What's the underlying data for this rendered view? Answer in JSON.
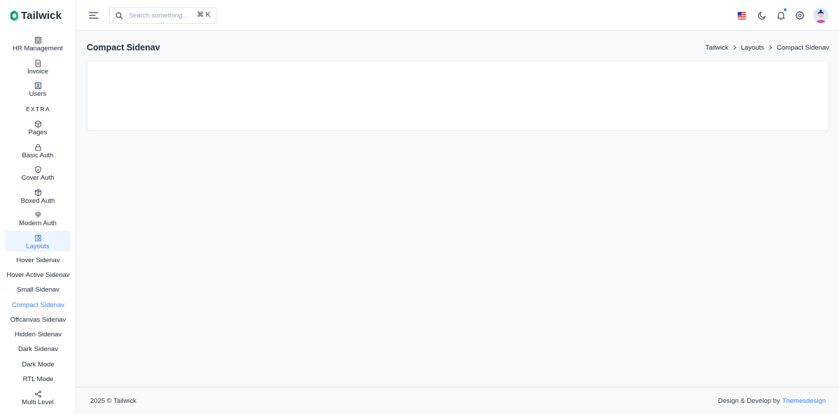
{
  "brand": {
    "name": "Tailwick",
    "color": "#10b981"
  },
  "sidebar": {
    "items": [
      {
        "label": "HR Management",
        "icon": "hr-icon"
      },
      {
        "label": "Invoice",
        "icon": "invoice-icon"
      },
      {
        "label": "Users",
        "icon": "users-icon"
      }
    ],
    "section_extra": "EXTRA",
    "extra_items": [
      {
        "label": "Pages",
        "icon": "pages-icon"
      },
      {
        "label": "Basic Auth",
        "icon": "lock-icon"
      },
      {
        "label": "Cover Auth",
        "icon": "shield-check-icon"
      },
      {
        "label": "Boxed Auth",
        "icon": "box-icon"
      },
      {
        "label": "Modern Auth",
        "icon": "fingerprint-icon"
      },
      {
        "label": "Layouts",
        "icon": "layouts-icon",
        "active": true
      }
    ],
    "layout_sub_items": [
      {
        "label": "Hover Sidenav"
      },
      {
        "label": "Hover Active Sidenav"
      },
      {
        "label": "Small Sidenav"
      },
      {
        "label": "Compact Sidenav",
        "active": true
      },
      {
        "label": "Offcanvas Sidenav"
      },
      {
        "label": "Hidden Sidenav"
      },
      {
        "label": "Dark Sidenav"
      },
      {
        "label": "Dark Mode"
      },
      {
        "label": "RTL Mode"
      }
    ],
    "multi_level": {
      "label": "Multi Level",
      "icon": "share-icon"
    }
  },
  "header": {
    "search_placeholder": "Search something...",
    "search_shortcut": "⌘ K",
    "icons": [
      "menu-icon",
      "us-flag-icon",
      "moon-icon",
      "bell-icon",
      "gear-icon",
      "avatar"
    ],
    "notification_dot_color": "#3b82f6"
  },
  "main": {
    "title": "Compact Sidenav",
    "breadcrumb": [
      "Tailwick",
      "Layouts",
      "Compact Sidenav"
    ]
  },
  "footer": {
    "copyright": "2025 © Tailwick",
    "credit_text": "Design & Develop by",
    "credit_link": "Themesdesign"
  },
  "colors": {
    "accent": "#3b82f6",
    "active_bg": "#eef4fe",
    "page_bg": "#f8f9fa"
  }
}
